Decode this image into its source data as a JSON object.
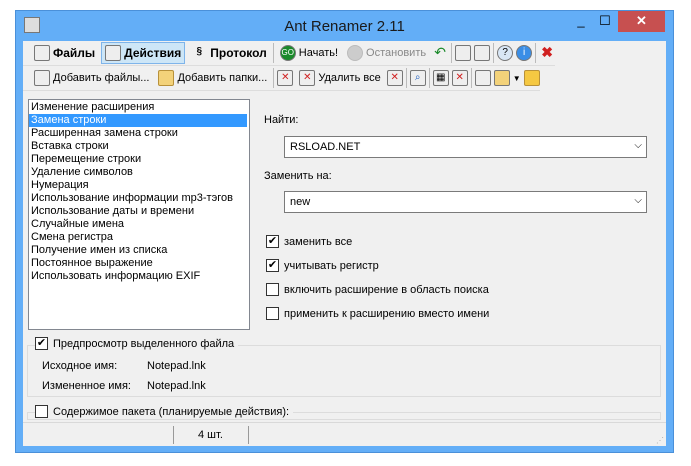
{
  "window": {
    "title": "Ant Renamer 2.11",
    "minimize": "_",
    "maximize": "☐",
    "close": "✕"
  },
  "toolbar1": {
    "files": "Файлы",
    "actions": "Действия",
    "log": "Протокол",
    "start": "Начать!",
    "stop": "Остановить"
  },
  "toolbar2": {
    "add_files": "Добавить файлы...",
    "add_folders": "Добавить папки...",
    "delete_all": "Удалить все"
  },
  "actions_list": {
    "selected_index": 1,
    "items": [
      "Изменение расширения",
      "Замена строки",
      "Расширенная замена строки",
      "Вставка строки",
      "Перемещение строки",
      "Удаление символов",
      "Нумерация",
      "Использование информации mp3-тэгов",
      "Использование даты и времени",
      "Случайные имена",
      "Смена регистра",
      "Получение имен из списка",
      "Постоянное выражение",
      "Использовать информацию EXIF"
    ]
  },
  "form": {
    "find_label": "Найти:",
    "find_value": "RSLOAD.NET",
    "replace_label": "Заменить на:",
    "replace_value": "new",
    "options": [
      {
        "label": "заменить все",
        "checked": true
      },
      {
        "label": "учитывать регистр",
        "checked": true
      },
      {
        "label": "включить расширение в область поиска",
        "checked": false
      },
      {
        "label": "применить к расширению вместо имени",
        "checked": false
      }
    ]
  },
  "preview": {
    "label": "Предпросмотр выделенного файла",
    "checked": true,
    "original_label": "Исходное имя:",
    "original_value": "Notepad.lnk",
    "new_label": "Измененное имя:",
    "new_value": "Notepad.lnk"
  },
  "batch": {
    "label": "Содержимое пакета (планируемые действия):",
    "checked": false
  },
  "status": {
    "count": "4 шт."
  }
}
